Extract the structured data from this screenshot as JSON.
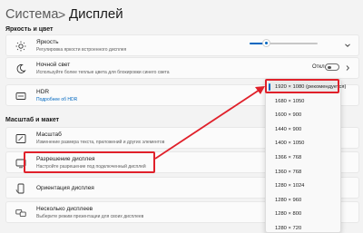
{
  "breadcrumb": {
    "parent": "Система",
    "separator": ">",
    "current": "Дисплей"
  },
  "sections": {
    "brightness": "Яркость и цвет",
    "scale": "Масштаб и макет"
  },
  "rows": {
    "brightness": {
      "title": "Яркость",
      "subtitle": "Регулировка яркости встроенного дисплея",
      "value": 0.25
    },
    "night_light": {
      "title": "Ночной свет",
      "subtitle": "Используйте более теплые цвета для блокировки синего света",
      "toggle_label": "Откл.",
      "toggle_on": false
    },
    "hdr": {
      "title": "HDR",
      "subtitle": "Подробнее об HDR"
    },
    "scale": {
      "title": "Масштаб",
      "subtitle": "Изменение размера текста, приложений и других элементов"
    },
    "resolution": {
      "title": "Разрешение дисплея",
      "subtitle": "Настройте разрешение под подключенный дисплей"
    },
    "orientation": {
      "title": "Ориентация дисплея"
    },
    "multiple": {
      "title": "Несколько дисплеев",
      "subtitle": "Выберите режим презентации для своих дисплеев"
    }
  },
  "resolution_options": [
    "1920 × 1080 (рекомендуется)",
    "1680 × 1050",
    "1600 × 900",
    "1440 × 900",
    "1400 × 1050",
    "1366 × 768",
    "1360 × 768",
    "1280 × 1024",
    "1280 × 960",
    "1280 × 800",
    "1280 × 720"
  ],
  "selected_index": 0,
  "icons": {
    "brightness": "sun-icon",
    "night_light": "moon-sun-icon",
    "hdr": "hdr-icon",
    "scale": "scale-icon",
    "resolution": "resolution-icon",
    "orientation": "orientation-icon",
    "multiple": "multiple-displays-icon"
  },
  "colors": {
    "accent": "#0067c0",
    "highlight": "#e0202a",
    "background": "#f3f3f3"
  }
}
